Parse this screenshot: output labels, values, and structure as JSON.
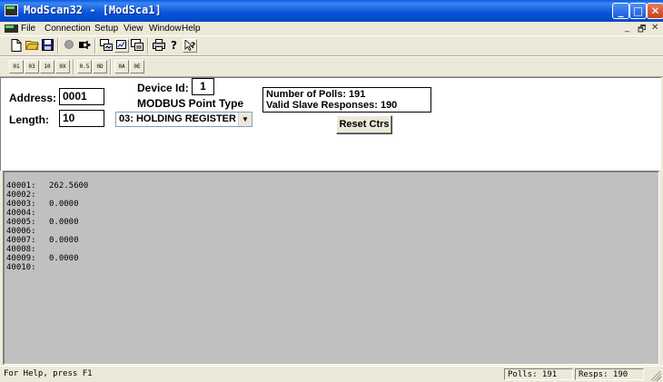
{
  "window": {
    "title": "ModScan32 - [ModSca1]"
  },
  "caption_buttons": {
    "minimize": "_",
    "maximize": "□",
    "close": "✕"
  },
  "menu": {
    "items": [
      "File",
      "Connection",
      "Setup",
      "View",
      "Window",
      "Help"
    ],
    "mdi_controls": [
      "_",
      "🗗",
      "✕"
    ]
  },
  "toolbar1": {
    "icons": [
      "new-file-icon",
      "open-folder-icon",
      "save-icon",
      "record-icon",
      "connect-icon",
      "setup-icon",
      "chart-icon",
      "display-icon",
      "print-icon",
      "help-icon",
      "context-help-icon"
    ]
  },
  "toolbar2": {
    "labels": [
      "01",
      "03",
      "10",
      "0X",
      "0.5",
      "0D",
      "0A",
      "0E"
    ]
  },
  "form": {
    "address_label": "Address:",
    "address_value": "0001",
    "length_label": "Length:",
    "length_value": "10",
    "device_id_label": "Device Id:",
    "device_id_value": "1",
    "point_type_label": "MODBUS Point Type",
    "point_type_value": "03: HOLDING REGISTER",
    "polls_text": "Number of Polls: 191",
    "valid_text": "Valid Slave Responses: 190",
    "reset_label": "Reset Ctrs"
  },
  "registers": [
    {
      "addr": "40001:",
      "value": "262.5600"
    },
    {
      "addr": "40002:",
      "value": ""
    },
    {
      "addr": "40003:",
      "value": "0.0000"
    },
    {
      "addr": "40004:",
      "value": ""
    },
    {
      "addr": "40005:",
      "value": "0.0000"
    },
    {
      "addr": "40006:",
      "value": ""
    },
    {
      "addr": "40007:",
      "value": "0.0000"
    },
    {
      "addr": "40008:",
      "value": ""
    },
    {
      "addr": "40009:",
      "value": "0.0000"
    },
    {
      "addr": "40010:",
      "value": ""
    }
  ],
  "status": {
    "help": "For Help, press F1",
    "polls": "Polls: 191",
    "resps": "Resps: 190"
  }
}
